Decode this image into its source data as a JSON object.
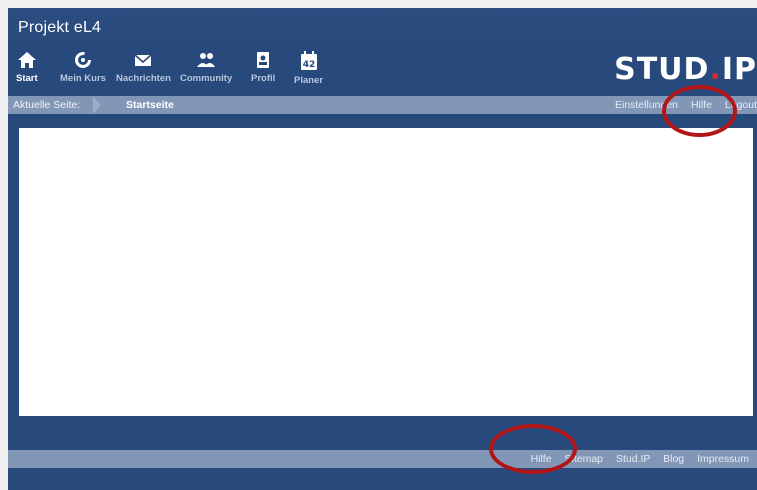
{
  "site": {
    "title": "Projekt eL4"
  },
  "nav": {
    "items": [
      {
        "label": "Start",
        "icon": "home-icon"
      },
      {
        "label": "Mein Kurs",
        "icon": "course-icon"
      },
      {
        "label": "Nachrichten",
        "icon": "mail-icon"
      },
      {
        "label": "Community",
        "icon": "community-icon"
      },
      {
        "label": "Profil",
        "icon": "profile-icon"
      },
      {
        "label": "Planer",
        "icon": "calendar-icon",
        "badge": "42"
      }
    ]
  },
  "logo": {
    "text_main": "STUD",
    "text_dot": ".",
    "text_end": "IP"
  },
  "breadcrumb": {
    "label": "Aktuelle Seite:",
    "current": "Startseite",
    "links": [
      "Einstellungen",
      "Hilfe",
      "Logout"
    ]
  },
  "footer": {
    "links": [
      "Hilfe",
      "Sitemap",
      "Stud.IP",
      "Blog",
      "Impressum"
    ]
  },
  "colors": {
    "background": "#28497c",
    "bar": "#8296b6",
    "highlight": "#b21516",
    "logo_dot": "#d62b2b"
  }
}
